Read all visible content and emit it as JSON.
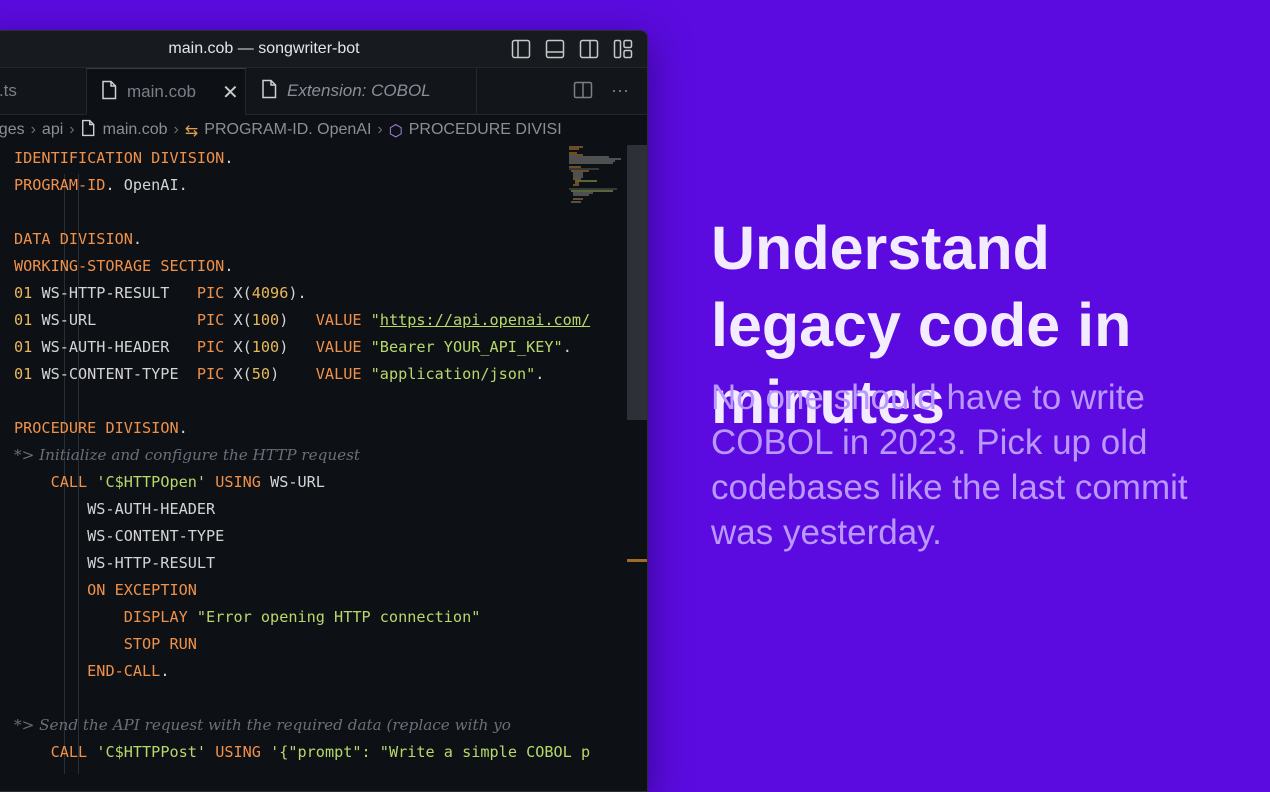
{
  "window": {
    "title": "main.cob — songwriter-bot"
  },
  "tabs": [
    {
      "label": "ex.ts"
    },
    {
      "label": "main.cob",
      "close": "✕"
    },
    {
      "label": "Extension: COBOL"
    }
  ],
  "tab_actions": {
    "more": "···"
  },
  "breadcrumb": [
    "pages",
    "api",
    "main.cob",
    "PROGRAM-ID. OpenAI",
    "PROCEDURE DIVISI"
  ],
  "code": {
    "lines": [
      "IDENTIFICATION DIVISION.",
      "PROGRAM-ID. OpenAI.",
      "",
      "DATA DIVISION.",
      "WORKING-STORAGE SECTION.",
      "01 WS-HTTP-RESULT   PIC X(4096).",
      "01 WS-URL           PIC X(100)   VALUE \"https://api.openai.com/",
      "01 WS-AUTH-HEADER   PIC X(100)   VALUE \"Bearer YOUR_API_KEY\".",
      "01 WS-CONTENT-TYPE  PIC X(50)    VALUE \"application/json\".",
      "",
      "PROCEDURE DIVISION.",
      "*> Initialize and configure the HTTP request",
      "    CALL 'C$HTTPOpen' USING WS-URL",
      "        WS-AUTH-HEADER",
      "        WS-CONTENT-TYPE",
      "        WS-HTTP-RESULT",
      "        ON EXCEPTION",
      "            DISPLAY \"Error opening HTTP connection\"",
      "            STOP RUN",
      "        END-CALL.",
      "",
      "*> Send the API request with the required data (replace with yo",
      "    CALL 'C$HTTPPost' USING '{\"prompt\": \"Write a simple COBOL p"
    ]
  },
  "hero": {
    "headline": "Understand legacy code in minutes",
    "subtext": "No one should have to write COBOL in 2023. Pick up old codebases like the last commit was yesterday."
  },
  "colors": {
    "background": "#5b0be0",
    "editor_bg": "#0d1015",
    "keyword": "#f0914a",
    "number": "#e8b85a",
    "string": "#b8d86a",
    "comment": "#6b6f78"
  }
}
